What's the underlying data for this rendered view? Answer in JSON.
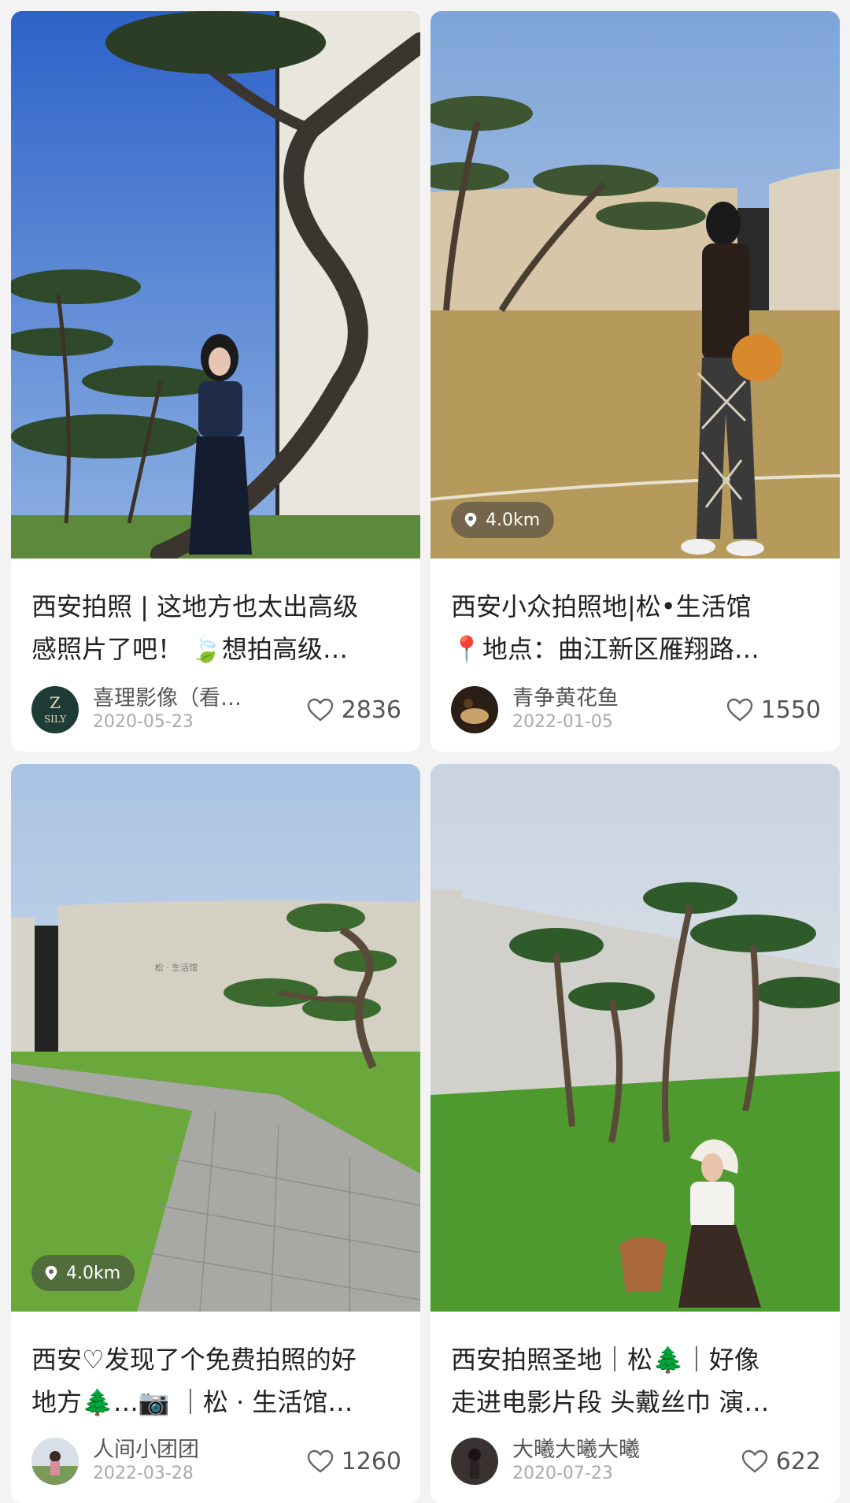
{
  "cards": [
    {
      "title_line1": "西安拍照 | 这地方也太出高级",
      "title_line2": "感照片了吧！ 🍃想拍高级…",
      "author": "喜理影像（看…",
      "date": "2020-05-23",
      "likes": "2836",
      "distance": ""
    },
    {
      "title_line1": "西安小众拍照地|松•生活馆",
      "title_line2": "📍地点：曲江新区雁翔路…",
      "author": "青争黄花鱼",
      "date": "2022-01-05",
      "likes": "1550",
      "distance": "4.0km"
    },
    {
      "title_line1": "西安♡发现了个免费拍照的好",
      "title_line2": "地方🌲…📷 ｜松 · 生活馆…",
      "author": "人间小团团",
      "date": "2022-03-28",
      "likes": "1260",
      "distance": "4.0km"
    },
    {
      "title_line1": "西安拍照圣地｜松🌲｜好像",
      "title_line2": "走进电影片段 头戴丝巾 演…",
      "author": "大曦大曦大曦",
      "date": "2020-07-23",
      "likes": "622",
      "distance": ""
    }
  ],
  "avatar_logo_text": "SILY",
  "wall_sign_text": "松 · 生活馆",
  "colors": {
    "background": "#f3f3f3",
    "card": "#ffffff",
    "title_text": "#222222",
    "meta_text": "#555555",
    "date_text": "#aaaaaa"
  },
  "icons": [
    "location-pin-icon",
    "heart-outline-icon"
  ]
}
